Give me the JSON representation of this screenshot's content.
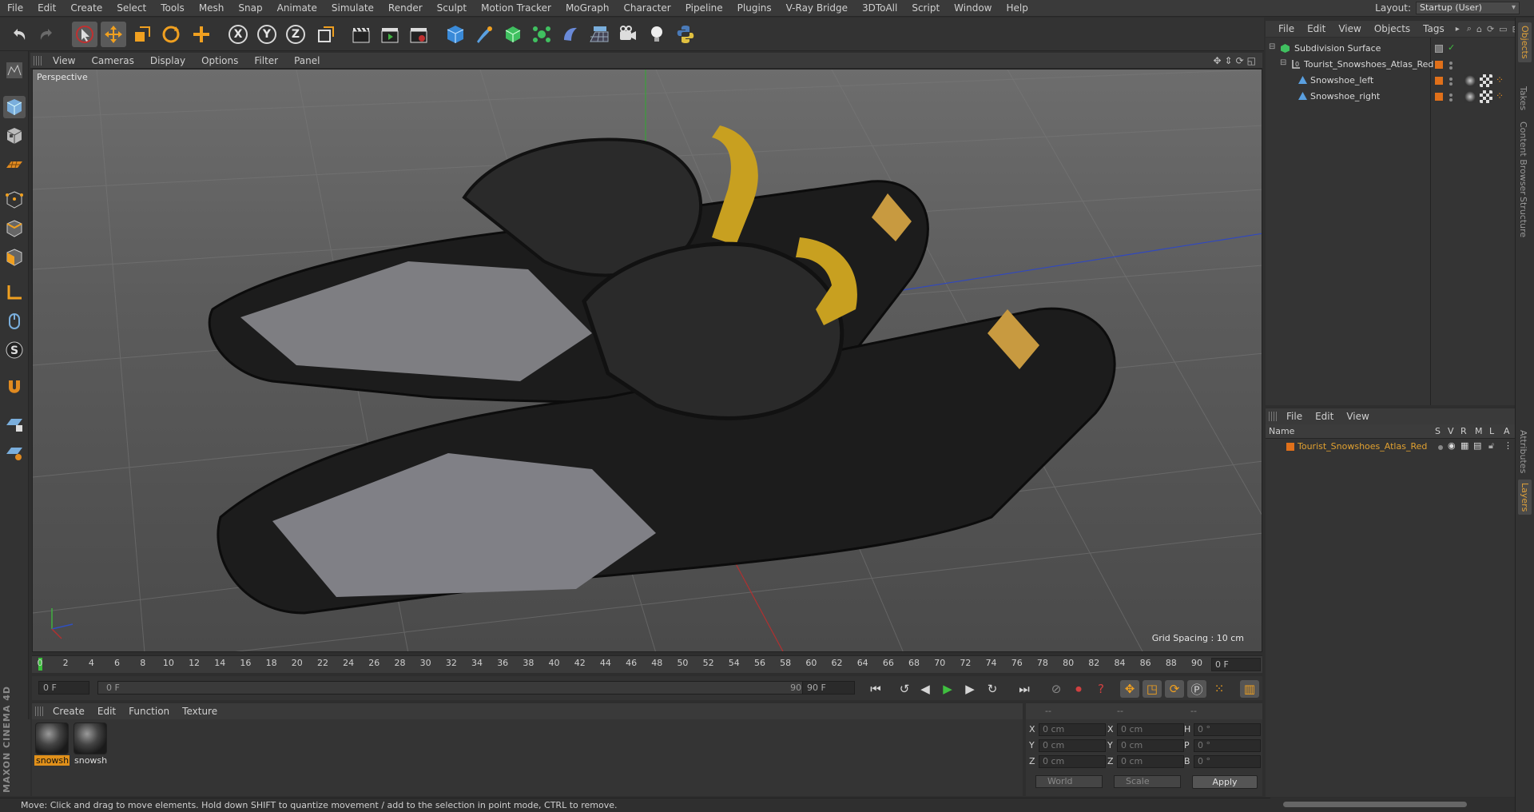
{
  "menubar": {
    "items": [
      "File",
      "Edit",
      "Create",
      "Select",
      "Tools",
      "Mesh",
      "Snap",
      "Animate",
      "Simulate",
      "Render",
      "Sculpt",
      "Motion Tracker",
      "MoGraph",
      "Character",
      "Pipeline",
      "Plugins",
      "V-Ray Bridge",
      "3DToAll",
      "Script",
      "Window",
      "Help"
    ],
    "layout_label": "Layout:",
    "layout_value": "Startup (User)"
  },
  "toolbar": {
    "axis_x": "X",
    "axis_y": "Y",
    "axis_z": "Z"
  },
  "viewport": {
    "menu": [
      "View",
      "Cameras",
      "Display",
      "Options",
      "Filter",
      "Panel"
    ],
    "camera_label": "Perspective",
    "grid_spacing": "Grid Spacing : 10 cm"
  },
  "timeline": {
    "ticks": [
      "0",
      "2",
      "4",
      "6",
      "8",
      "10",
      "12",
      "14",
      "16",
      "18",
      "20",
      "22",
      "24",
      "26",
      "28",
      "30",
      "32",
      "34",
      "36",
      "38",
      "40",
      "42",
      "44",
      "46",
      "48",
      "50",
      "52",
      "54",
      "56",
      "58",
      "60",
      "62",
      "64",
      "66",
      "68",
      "70",
      "72",
      "74",
      "76",
      "78",
      "80",
      "82",
      "84",
      "86",
      "88",
      "90"
    ],
    "end_frame": "0 F"
  },
  "transport": {
    "start_field": "0 F",
    "range_start": "0 F",
    "range_end": "90 F",
    "max_field": "90 F",
    "current_position": 0.0
  },
  "materials": {
    "menu": [
      "Create",
      "Edit",
      "Function",
      "Texture"
    ],
    "items": [
      {
        "label": "snowsh",
        "selected": true
      },
      {
        "label": "snowsh",
        "selected": false
      }
    ]
  },
  "coords": {
    "header_a": "--",
    "header_b": "--",
    "header_c": "--",
    "rows": [
      {
        "axis": "X",
        "pos": "0 cm",
        "size": "0 cm",
        "rot_label": "H",
        "rot": "0 °"
      },
      {
        "axis": "Y",
        "pos": "0 cm",
        "size": "0 cm",
        "rot_label": "P",
        "rot": "0 °"
      },
      {
        "axis": "Z",
        "pos": "0 cm",
        "size": "0 cm",
        "rot_label": "B",
        "rot": "0 °"
      }
    ],
    "space": "World",
    "mode": "Scale",
    "apply": "Apply"
  },
  "status": {
    "text": "Move: Click and drag to move elements. Hold down SHIFT to quantize movement / add to the selection in point mode, CTRL to remove."
  },
  "branding": "MAXON CINEMA 4D",
  "object_manager": {
    "menu": [
      "File",
      "Edit",
      "View",
      "Objects",
      "Tags"
    ],
    "objects": [
      {
        "name": "Subdivision Surface",
        "level": 0
      },
      {
        "name": "Tourist_Snowshoes_Atlas_Red",
        "level": 1
      },
      {
        "name": "Snowshoe_left",
        "level": 2
      },
      {
        "name": "Snowshoe_right",
        "level": 2
      }
    ]
  },
  "layers": {
    "menu": [
      "File",
      "Edit",
      "View"
    ],
    "columns": {
      "name": "Name",
      "s": "S",
      "v": "V",
      "r": "R",
      "m": "M",
      "l": "L",
      "a": "A"
    },
    "items": [
      {
        "name": "Tourist_Snowshoes_Atlas_Red"
      }
    ]
  },
  "side_tabs": [
    "Objects",
    "Takes",
    "Content Browser",
    "Structure",
    "Attributes",
    "Layers"
  ],
  "colors": {
    "accent_orange": "#e0901a",
    "layer_name": "#e0a030",
    "axis_x": "#c23030",
    "axis_y": "#40b040",
    "axis_z": "#3050c0"
  }
}
